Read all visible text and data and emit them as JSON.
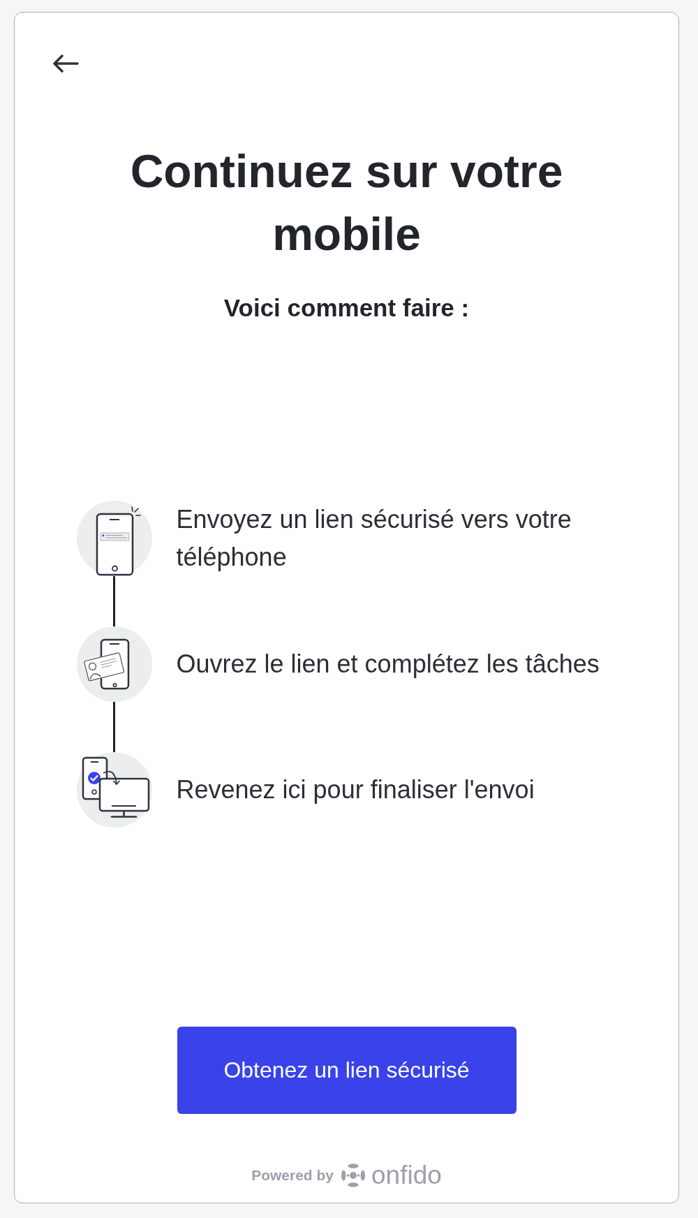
{
  "title": "Continuez sur votre mobile",
  "subtitle": "Voici comment faire :",
  "steps": [
    {
      "kind": "send",
      "text": "Envoyez un lien sécurisé vers votre téléphone"
    },
    {
      "kind": "tasks",
      "text": "Ouvrez le lien et complétez les tâches"
    },
    {
      "kind": "return",
      "text": "Revenez ici pour finaliser l'envoi"
    }
  ],
  "button": {
    "label": "Obtenez un lien sécurisé"
  },
  "footer": {
    "prefix": "Powered by",
    "brand": "onfido"
  }
}
